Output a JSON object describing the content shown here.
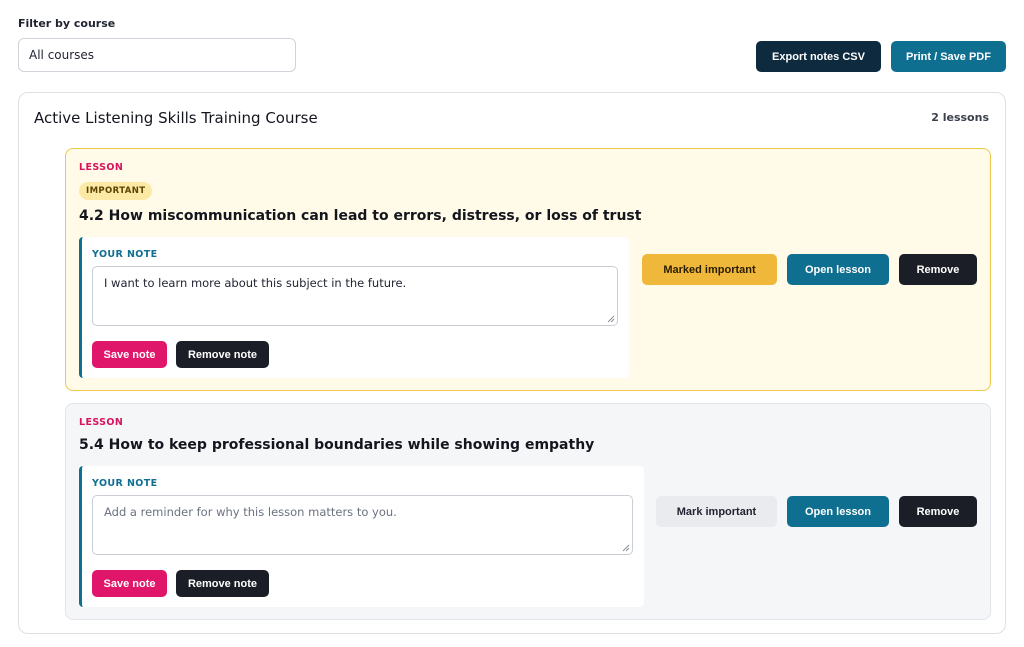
{
  "filter": {
    "label": "Filter by course",
    "selected": "All courses"
  },
  "toolbar": {
    "export_label": "Export notes CSV",
    "print_label": "Print / Save PDF"
  },
  "course": {
    "title": "Active Listening Skills Training Course",
    "lesson_count": "2 lessons",
    "lessons": [
      {
        "kicker": "LESSON",
        "badge": "IMPORTANT",
        "title": "4.2 How miscommunication can lead to errors, distress, or loss of trust",
        "note_label": "YOUR NOTE",
        "note_value": "I want to learn more about this subject in the future.",
        "save_label": "Save note",
        "remove_note_label": "Remove note",
        "important_label": "Marked important",
        "open_label": "Open lesson",
        "remove_label": "Remove"
      },
      {
        "kicker": "LESSON",
        "title": "5.4 How to keep professional boundaries while showing empathy",
        "note_label": "YOUR NOTE",
        "note_placeholder": "Add a reminder for why this lesson matters to you.",
        "save_label": "Save note",
        "remove_note_label": "Remove note",
        "important_label": "Mark important",
        "open_label": "Open lesson",
        "remove_label": "Remove"
      }
    ]
  },
  "colors": {
    "accent_teal": "#0f6f91",
    "accent_pink": "#e0166a",
    "navy": "#0e2a3f",
    "important_amber": "#f0b83a"
  }
}
